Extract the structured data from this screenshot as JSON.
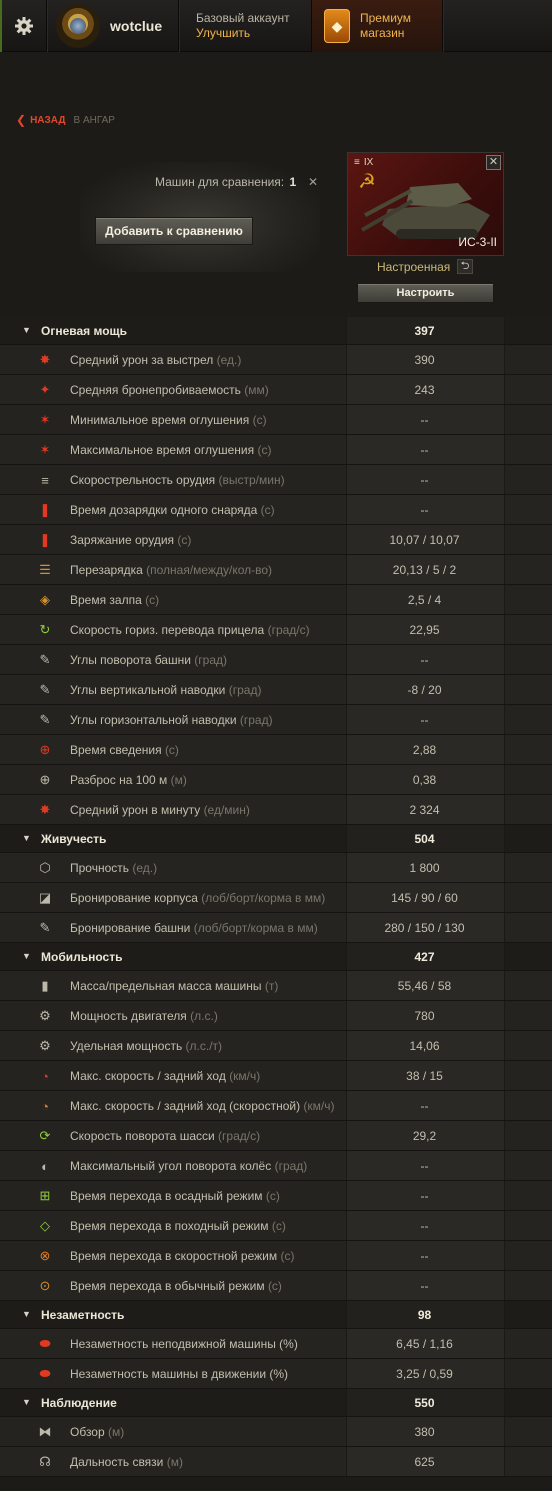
{
  "header": {
    "username": "wotclue",
    "account_type": "Базовый аккаунт",
    "account_upgrade": "Улучшить",
    "premium_shop_line1": "Премиум",
    "premium_shop_line2": "магазин"
  },
  "nav": {
    "back": "НАЗАД",
    "back_target": "В АНГАР"
  },
  "compare": {
    "count_label": "Машин для сравнения:",
    "count": "1",
    "add_button": "Добавить к сравнению"
  },
  "tank": {
    "tier": "IX",
    "name": "ИС-3-II",
    "state": "Настроенная",
    "setup_button": "Настроить"
  },
  "colors": {
    "accent_red": "#e2482c",
    "premium_orange": "#f0b44c",
    "panel_bg": "#24231f"
  },
  "sections": [
    {
      "title": "Огневая мощь",
      "value": "397",
      "rows": [
        {
          "icon": "damage-icon",
          "label": "Средний урон за выстрел",
          "unit": "(ед.)",
          "value": "390"
        },
        {
          "icon": "penetration-icon",
          "label": "Средняя бронепробиваемость",
          "unit": "(мм)",
          "value": "243"
        },
        {
          "icon": "stun-min-icon",
          "label": "Минимальное время оглушения",
          "unit": "(с)",
          "value": "--"
        },
        {
          "icon": "stun-max-icon",
          "label": "Максимальное время оглушения",
          "unit": "(с)",
          "value": "--"
        },
        {
          "icon": "rate-of-fire-icon",
          "label": "Скорострельность орудия",
          "unit": "(выстр/мин)",
          "value": "--"
        },
        {
          "icon": "shell-reload-icon",
          "label": "Время дозарядки одного снаряда",
          "unit": "(с)",
          "value": "--"
        },
        {
          "icon": "loading-icon",
          "label": "Заряжание орудия",
          "unit": "(с)",
          "value": "10,07 / 10,07"
        },
        {
          "icon": "clip-reload-icon",
          "label": "Перезарядка",
          "unit": "(полная/между/кол-во)",
          "value": "20,13 / 5 / 2"
        },
        {
          "icon": "salvo-icon",
          "label": "Время залпа",
          "unit": "(с)",
          "value": "2,5 / 4"
        },
        {
          "icon": "aim-traverse-icon",
          "label": "Скорость гориз. перевода прицела",
          "unit": "(град/с)",
          "value": "22,95"
        },
        {
          "icon": "turret-angle-icon",
          "label": "Углы поворота башни",
          "unit": "(град)",
          "value": "--"
        },
        {
          "icon": "elevation-icon",
          "label": "Углы вертикальной наводки",
          "unit": "(град)",
          "value": "-8 / 20"
        },
        {
          "icon": "horizontal-aim-icon",
          "label": "Углы горизонтальной наводки",
          "unit": "(град)",
          "value": "--"
        },
        {
          "icon": "aiming-time-icon",
          "label": "Время сведения",
          "unit": "(с)",
          "value": "2,88"
        },
        {
          "icon": "dispersion-icon",
          "label": "Разброс на 100 м",
          "unit": "(м)",
          "value": "0,38"
        },
        {
          "icon": "dpm-icon",
          "label": "Средний урон в минуту",
          "unit": "(ед/мин)",
          "value": "2 324"
        }
      ]
    },
    {
      "title": "Живучесть",
      "value": "504",
      "rows": [
        {
          "icon": "hitpoints-icon",
          "label": "Прочность",
          "unit": "(ед.)",
          "value": "1 800"
        },
        {
          "icon": "hull-armor-icon",
          "label": "Бронирование корпуса",
          "unit": "(лоб/борт/корма в мм)",
          "value": "145 / 90 / 60"
        },
        {
          "icon": "turret-armor-icon",
          "label": "Бронирование башни",
          "unit": "(лоб/борт/корма в мм)",
          "value": "280 / 150 / 130"
        }
      ]
    },
    {
      "title": "Мобильность",
      "value": "427",
      "rows": [
        {
          "icon": "weight-icon",
          "label": "Масса/предельная масса машины",
          "unit": "(т)",
          "value": "55,46 / 58"
        },
        {
          "icon": "engine-icon",
          "label": "Мощность двигателя",
          "unit": "(л.с.)",
          "value": "780"
        },
        {
          "icon": "power-ratio-icon",
          "label": "Удельная мощность",
          "unit": "(л.с./т)",
          "value": "14,06"
        },
        {
          "icon": "speed-icon",
          "label": "Макс. скорость / задний ход",
          "unit": "(км/ч)",
          "value": "38 / 15"
        },
        {
          "icon": "speed-fast-icon",
          "label": "Макс. скорость / задний ход (скоростной)",
          "unit": "(км/ч)",
          "value": "--"
        },
        {
          "icon": "traverse-icon",
          "label": "Скорость поворота шасси",
          "unit": "(град/с)",
          "value": "29,2"
        },
        {
          "icon": "wheel-angle-icon",
          "label": "Максимальный угол поворота колёс",
          "unit": "(град)",
          "value": "--"
        },
        {
          "icon": "siege-mode-icon",
          "label": "Время перехода в осадный режим",
          "unit": "(с)",
          "value": "--"
        },
        {
          "icon": "travel-mode-icon",
          "label": "Время перехода в походный режим",
          "unit": "(с)",
          "value": "--"
        },
        {
          "icon": "fast-mode-icon",
          "label": "Время перехода в скоростной режим",
          "unit": "(с)",
          "value": "--"
        },
        {
          "icon": "normal-mode-icon",
          "label": "Время перехода в обычный режим",
          "unit": "(с)",
          "value": "--"
        }
      ]
    },
    {
      "title": "Незаметность",
      "value": "98",
      "rows": [
        {
          "icon": "camo-still-icon",
          "label": "Незаметность неподвижной машины (%)",
          "unit": "",
          "value": "6,45 / 1,16"
        },
        {
          "icon": "camo-moving-icon",
          "label": "Незаметность машины в движении (%)",
          "unit": "",
          "value": "3,25 / 0,59"
        }
      ]
    },
    {
      "title": "Наблюдение",
      "value": "550",
      "rows": [
        {
          "icon": "view-range-icon",
          "label": "Обзор",
          "unit": "(м)",
          "value": "380"
        },
        {
          "icon": "radio-range-icon",
          "label": "Дальность связи",
          "unit": "(м)",
          "value": "625"
        }
      ]
    }
  ]
}
